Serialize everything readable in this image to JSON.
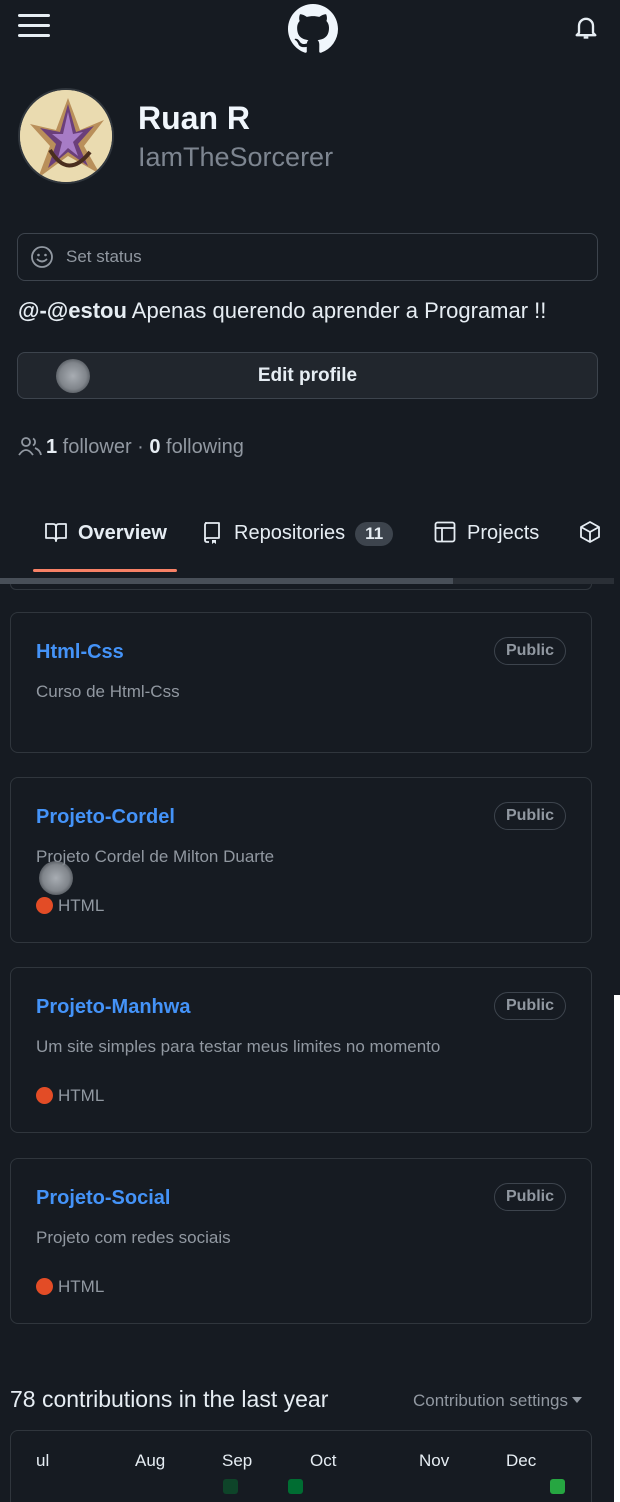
{
  "profile": {
    "display_name": "Ruan R",
    "username": "IamTheSorcerer",
    "status_label": "Set status",
    "bio_handle": "@-@estou",
    "bio_text": " Apenas querendo aprender a Programar !!",
    "edit_label": "Edit profile",
    "followers_count": "1",
    "followers_label": " follower · ",
    "following_count": "0",
    "following_label": " following"
  },
  "tabs": [
    {
      "label": "Overview",
      "icon": "book-icon",
      "active": true
    },
    {
      "label": "Repositories",
      "icon": "repo-icon",
      "count": "11"
    },
    {
      "label": "Projects",
      "icon": "table-icon"
    },
    {
      "label": "",
      "icon": "package-icon"
    }
  ],
  "repos": [
    {
      "name": "Html-Css",
      "visibility": "Public",
      "description": "Curso de Html-Css",
      "language": ""
    },
    {
      "name": "Projeto-Cordel",
      "visibility": "Public",
      "description": "Projeto Cordel de Milton Duarte",
      "language": "HTML"
    },
    {
      "name": "Projeto-Manhwa",
      "visibility": "Public",
      "description": "Um site simples para testar meus limites no momento",
      "language": "HTML"
    },
    {
      "name": "Projeto-Social",
      "visibility": "Public",
      "description": "Projeto com redes sociais",
      "language": "HTML"
    }
  ],
  "contributions": {
    "title": "78 contributions in the last year",
    "settings_label": "Contribution settings",
    "months": [
      "ul",
      "Aug",
      "Sep",
      "Oct",
      "Nov",
      "Dec"
    ]
  },
  "colors": {
    "background": "#161b22",
    "link": "#4493f8",
    "tab_accent": "#f78166",
    "html_language": "#e34c26",
    "contribution_low": "#0e4429",
    "contribution_mid": "#006d32",
    "contribution_high": "#26a641"
  }
}
